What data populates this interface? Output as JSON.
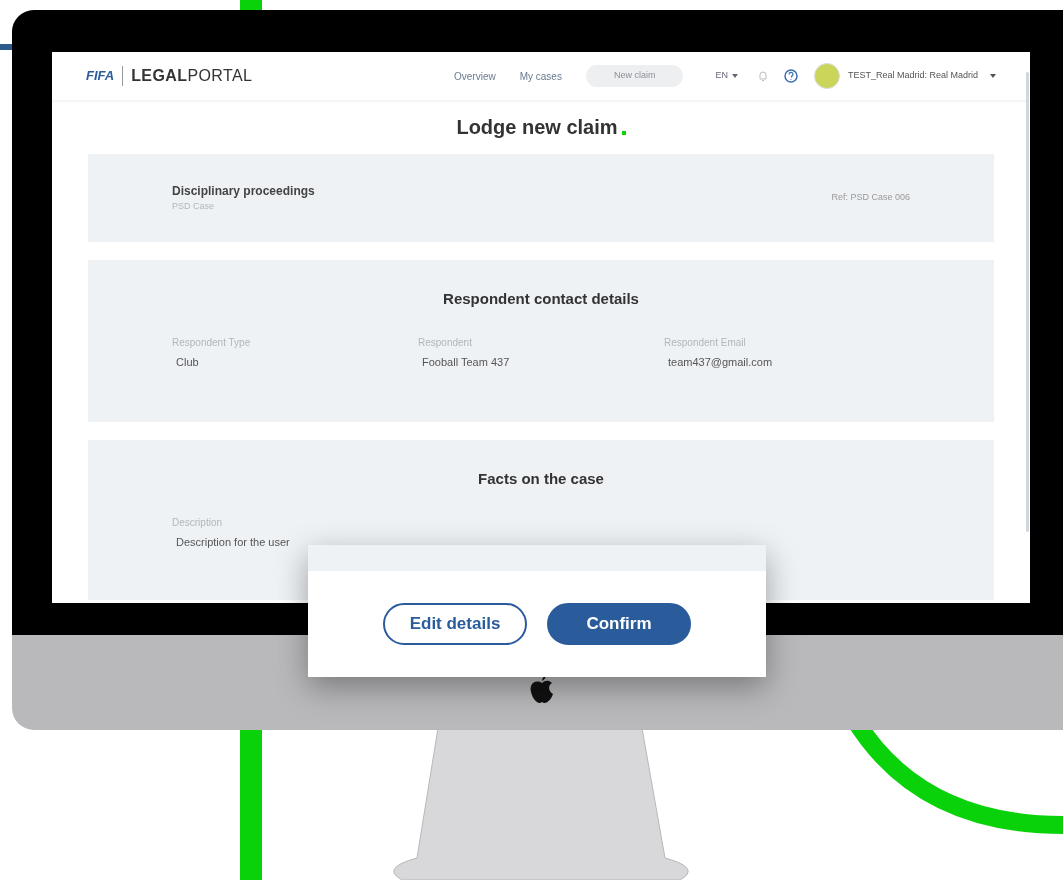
{
  "header": {
    "logo_brand": "FIFA",
    "logo_word_bold": "LEGAL",
    "logo_word_light": "PORTAL",
    "nav": [
      {
        "label": "Overview",
        "selected": false
      },
      {
        "label": "My cases",
        "selected": false
      }
    ],
    "new_claim_button": {
      "label": "New claim",
      "disabled": true
    },
    "language": "EN",
    "user": "TEST_Real Madrid: Real Madrid"
  },
  "page_title": "Lodge new claim",
  "case": {
    "title": "Disciplinary proceedings",
    "subtitle": "PSD Case",
    "reference": "Ref: PSD Case 006"
  },
  "respondent": {
    "heading": "Respondent contact details",
    "fields": [
      {
        "label": "Respondent Type",
        "value": "Club"
      },
      {
        "label": "Respondent",
        "value": "Fooball Team 437"
      },
      {
        "label": "Respondent Email",
        "value": "team437@gmail.com"
      }
    ]
  },
  "facts": {
    "heading": "Facts on the case",
    "fields": [
      {
        "label": "Description",
        "value": "Description for the user"
      }
    ]
  },
  "dialog": {
    "buttons": [
      {
        "label": "Edit details",
        "kind": "outline"
      },
      {
        "label": "Confirm",
        "kind": "primary"
      }
    ]
  }
}
